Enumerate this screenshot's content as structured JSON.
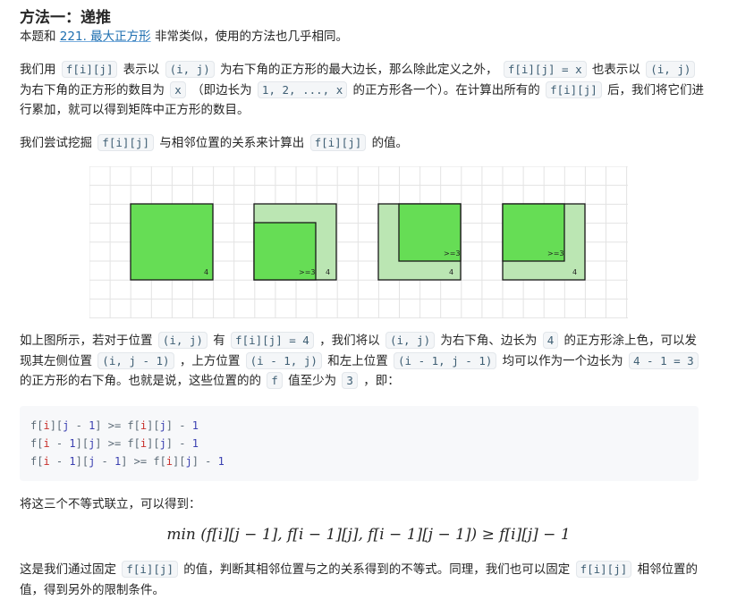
{
  "title": "方法一：递推",
  "p1": {
    "t1": "本题和 ",
    "link": "221. 最大正方形",
    "t2": " 非常类似，使用的方法也几乎相同。"
  },
  "p2": {
    "t1": "我们用",
    "c1": "f[i][j]",
    "t2": "表示以",
    "c2": "(i, j)",
    "t3": "为右下角的正方形的最大边长，那么除此定义之外，",
    "c3": "f[i][j] = x",
    "t4": "也表示以",
    "c4": "(i, j)",
    "t5": "为右下角的正方形的数目为",
    "c5": "x",
    "t6": "（即边长为",
    "c6": "1, 2, ..., x",
    "t7": "的正方形各一个）。在计算出所有的",
    "c7": "f[i][j]",
    "t8": "后，我们将它们进行累加，就可以得到矩阵中正方形的数目。"
  },
  "p3": {
    "t1": "我们尝试挖掘",
    "c1": "f[i][j]",
    "t2": "与相邻位置的关系来计算出",
    "c2": "f[i][j]",
    "t3": "的值。"
  },
  "figure": {
    "colors": {
      "dark": "#66dd55",
      "light": "#bbe6b3",
      "grid": "#e3e3e3",
      "edge": "#1a1a1a"
    },
    "labels": {
      "s1_corner": "4",
      "s2_inner": ">=3",
      "s2_corner": "4",
      "s3_inner": ">=3",
      "s3_corner": "4",
      "s4_inner": ">=3",
      "s4_corner": "4"
    }
  },
  "p4": {
    "t1": "如上图所示，若对于位置",
    "c1": "(i, j)",
    "t2": "有",
    "c2": "f[i][j] = 4",
    "t3": "，我们将以",
    "c3": "(i, j)",
    "t4": "为右下角、边长为",
    "c4": "4",
    "t5": "的正方形涂上色，可以发现其左侧位置",
    "c5": "(i, j - 1)",
    "t6": "，上方位置",
    "c6": "(i - 1, j)",
    "t7": "和左上位置",
    "c7": "(i - 1, j - 1)",
    "t8": "均可以作为一个边长为",
    "c8": "4 - 1 = 3",
    "t9": "的正方形的右下角。也就是说，这些位置的的",
    "c9": "f",
    "t10": "值至少为",
    "c10": "3",
    "t11": "，即："
  },
  "code": {
    "lines": [
      "f[i][j - 1] >= f[i][j] - 1",
      "f[i - 1][j] >= f[i][j] - 1",
      "f[i - 1][j - 1] >= f[i][j] - 1"
    ]
  },
  "p5": {
    "t1": "将这三个不等式联立，可以得到："
  },
  "formula": {
    "text": "min (f[i][j − 1], f[i − 1][j], f[i − 1][j − 1]) ≥ f[i][j] − 1"
  },
  "p6": {
    "t1": "这是我们通过固定",
    "c1": "f[i][j]",
    "t2": "的值，判断其相邻位置与之的关系得到的不等式。同理，我们也可以固定",
    "c2": "f[i][j]",
    "t3": "相邻位置的值，得到另外的限制条件。"
  }
}
